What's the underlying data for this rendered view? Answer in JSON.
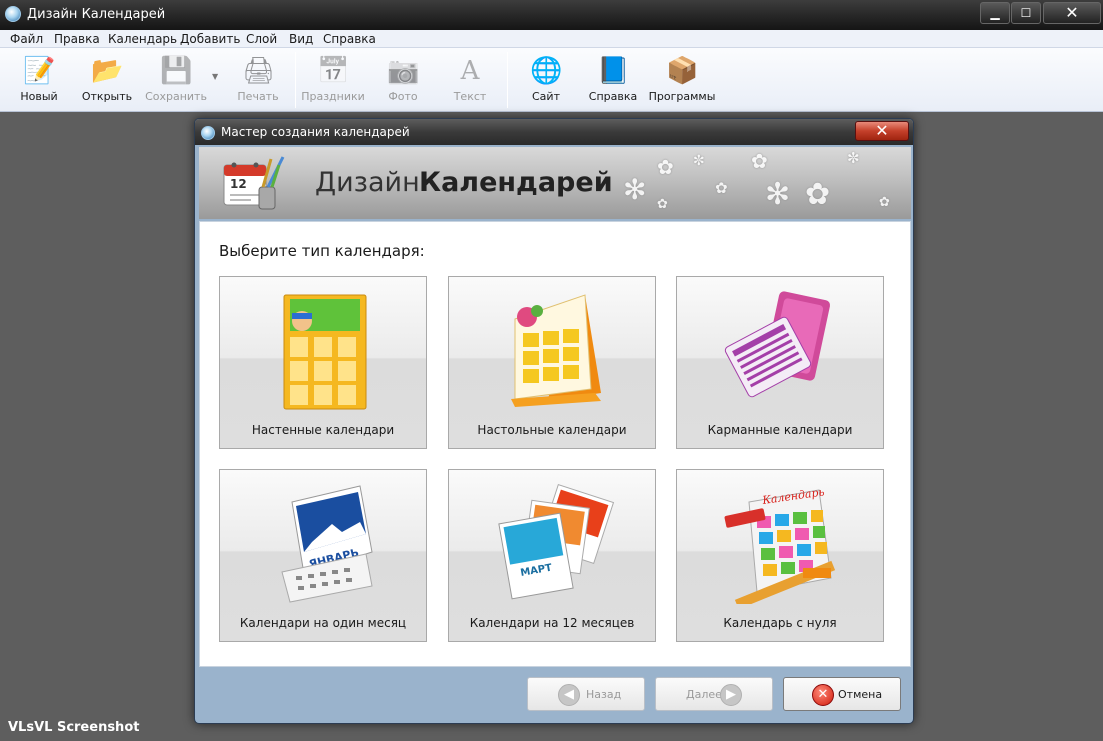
{
  "window": {
    "title": "Дизайн Календарей",
    "controls": {
      "minimize": "▁",
      "maximize": "☐",
      "close": "✕"
    }
  },
  "menu": [
    "Файл",
    "Правка",
    "Календарь",
    "Добавить",
    "Слой",
    "Вид",
    "Справка"
  ],
  "toolbar": [
    {
      "label": "Новый",
      "icon": "new-document-icon",
      "glyph": "📝",
      "enabled": true
    },
    {
      "label": "Открыть",
      "icon": "open-folder-icon",
      "glyph": "📂",
      "enabled": true
    },
    {
      "label": "Сохранить",
      "icon": "save-disk-icon",
      "glyph": "💾",
      "enabled": false
    },
    {
      "label": "Печать",
      "icon": "printer-icon",
      "glyph": "🖨",
      "enabled": false
    },
    {
      "label": "Праздники",
      "icon": "holiday-calendar-icon",
      "glyph": "📅",
      "enabled": false
    },
    {
      "label": "Фото",
      "icon": "camera-icon",
      "glyph": "📷",
      "enabled": false
    },
    {
      "label": "Текст",
      "icon": "text-letter-icon",
      "glyph": "A",
      "enabled": false
    },
    {
      "label": "Сайт",
      "icon": "globe-icon",
      "glyph": "🌐",
      "enabled": true
    },
    {
      "label": "Справка",
      "icon": "help-book-icon",
      "glyph": "📘",
      "enabled": true
    },
    {
      "label": "Программы",
      "icon": "programs-box-icon",
      "glyph": "📦",
      "enabled": true
    }
  ],
  "dialog": {
    "title": "Мастер создания календарей",
    "close": "✕",
    "banner": {
      "title_light": "Дизайн",
      "title_bold": "Календарей",
      "logo_day": "12"
    },
    "prompt": "Выберите тип календаря:",
    "cards": [
      {
        "label": "Настенные календари",
        "icon": "wall-calendar-icon"
      },
      {
        "label": "Настольные календари",
        "icon": "desk-calendar-icon"
      },
      {
        "label": "Карманные календари",
        "icon": "pocket-calendar-icon"
      },
      {
        "label": "Календари на один месяц",
        "icon": "monthly-calendar-icon",
        "month": "ЯНВАРЬ"
      },
      {
        "label": "Календари на 12 месяцев",
        "icon": "twelve-month-calendar-icon",
        "month": "МАРТ"
      },
      {
        "label": "Календарь с нуля",
        "icon": "blank-calendar-icon",
        "word": "Календарь"
      }
    ],
    "buttons": {
      "back": {
        "label": "Назад",
        "glyph": "◀",
        "enabled": false
      },
      "next": {
        "label": "Далее",
        "glyph": "▶",
        "enabled": false
      },
      "cancel": {
        "label": "Отмена",
        "glyph": "✕",
        "enabled": true
      }
    }
  },
  "watermark": "VLsVL Screenshot",
  "colors": {
    "accent": "#2a6fa8",
    "cancel": "#d01a0a",
    "wall_calendar": "#f5b820",
    "desk_calendar": "#f59a1e",
    "pocket_calendar": "#a43fa8"
  }
}
